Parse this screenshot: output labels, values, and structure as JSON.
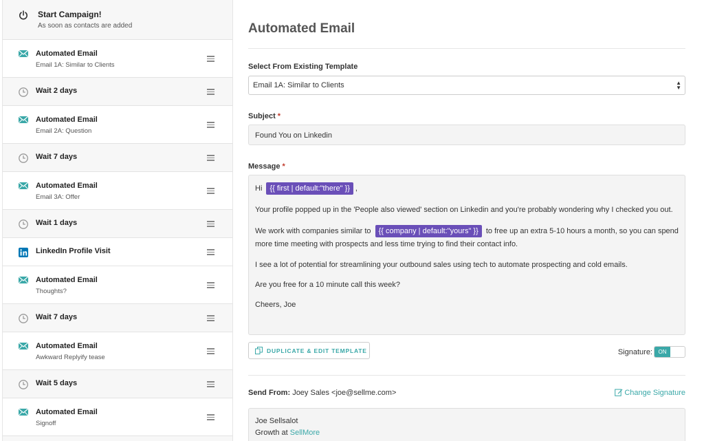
{
  "sidebar": {
    "start": {
      "title": "Start Campaign!",
      "subtitle": "As soon as contacts are added"
    },
    "steps": [
      {
        "type": "email",
        "title": "Automated Email",
        "subtitle": "Email 1A: Similar to Clients"
      },
      {
        "type": "wait",
        "title": "Wait 2 days"
      },
      {
        "type": "email",
        "title": "Automated Email",
        "subtitle": "Email 2A: Question"
      },
      {
        "type": "wait",
        "title": "Wait 7 days"
      },
      {
        "type": "email",
        "title": "Automated Email",
        "subtitle": "Email 3A: Offer"
      },
      {
        "type": "wait",
        "title": "Wait 1 days"
      },
      {
        "type": "linkedin",
        "title": "LinkedIn Profile Visit"
      },
      {
        "type": "email",
        "title": "Automated Email",
        "subtitle": "Thoughts?"
      },
      {
        "type": "wait",
        "title": "Wait 7 days"
      },
      {
        "type": "email",
        "title": "Automated Email",
        "subtitle": "Awkward Replyify tease"
      },
      {
        "type": "wait",
        "title": "Wait 5 days"
      },
      {
        "type": "email",
        "title": "Automated Email",
        "subtitle": "Signoff"
      }
    ]
  },
  "main": {
    "title": "Automated Email",
    "template_label": "Select From Existing Template",
    "template_value": "Email 1A: Similar to Clients",
    "subject_label": "Subject",
    "required_mark": "*",
    "subject_value": "Found You on Linkedin",
    "message_label": "Message",
    "message": {
      "greeting": "Hi",
      "tag_first": "{{ first | default:\"there\" }}",
      "greeting_end": ",",
      "p1": "Your profile popped up in the 'People also viewed' section on Linkedin and you're probably wondering why I checked you out.",
      "p2_start": "We work with companies similar to",
      "tag_company": "{{ company | default:\"yours\" }}",
      "p2_end": "to free up an extra 5-10 hours a month, so you can spend",
      "p2_line2": "more time meeting with prospects and less time trying to find their contact info.",
      "p3": "I see a lot of potential for streamlining your outbound sales using tech to automate prospecting and cold emails.",
      "p4": "Are you free for a 10 minute call this week?",
      "p5": "Cheers, Joe"
    },
    "duplicate_button": "DUPLICATE & EDIT TEMPLATE",
    "signature_label": "Signature:",
    "signature_toggle": "ON",
    "send_from_label": "Send From:",
    "send_from_value": "Joey Sales <joe@sellme.com>",
    "change_signature": "Change Signature",
    "signature": {
      "name": "Joe Sellsalot",
      "role": "Growth at",
      "company": "SellMore"
    }
  },
  "colors": {
    "accent": "#3aa8a8",
    "tag": "#6a4fb8",
    "linkedin": "#0077b5"
  }
}
